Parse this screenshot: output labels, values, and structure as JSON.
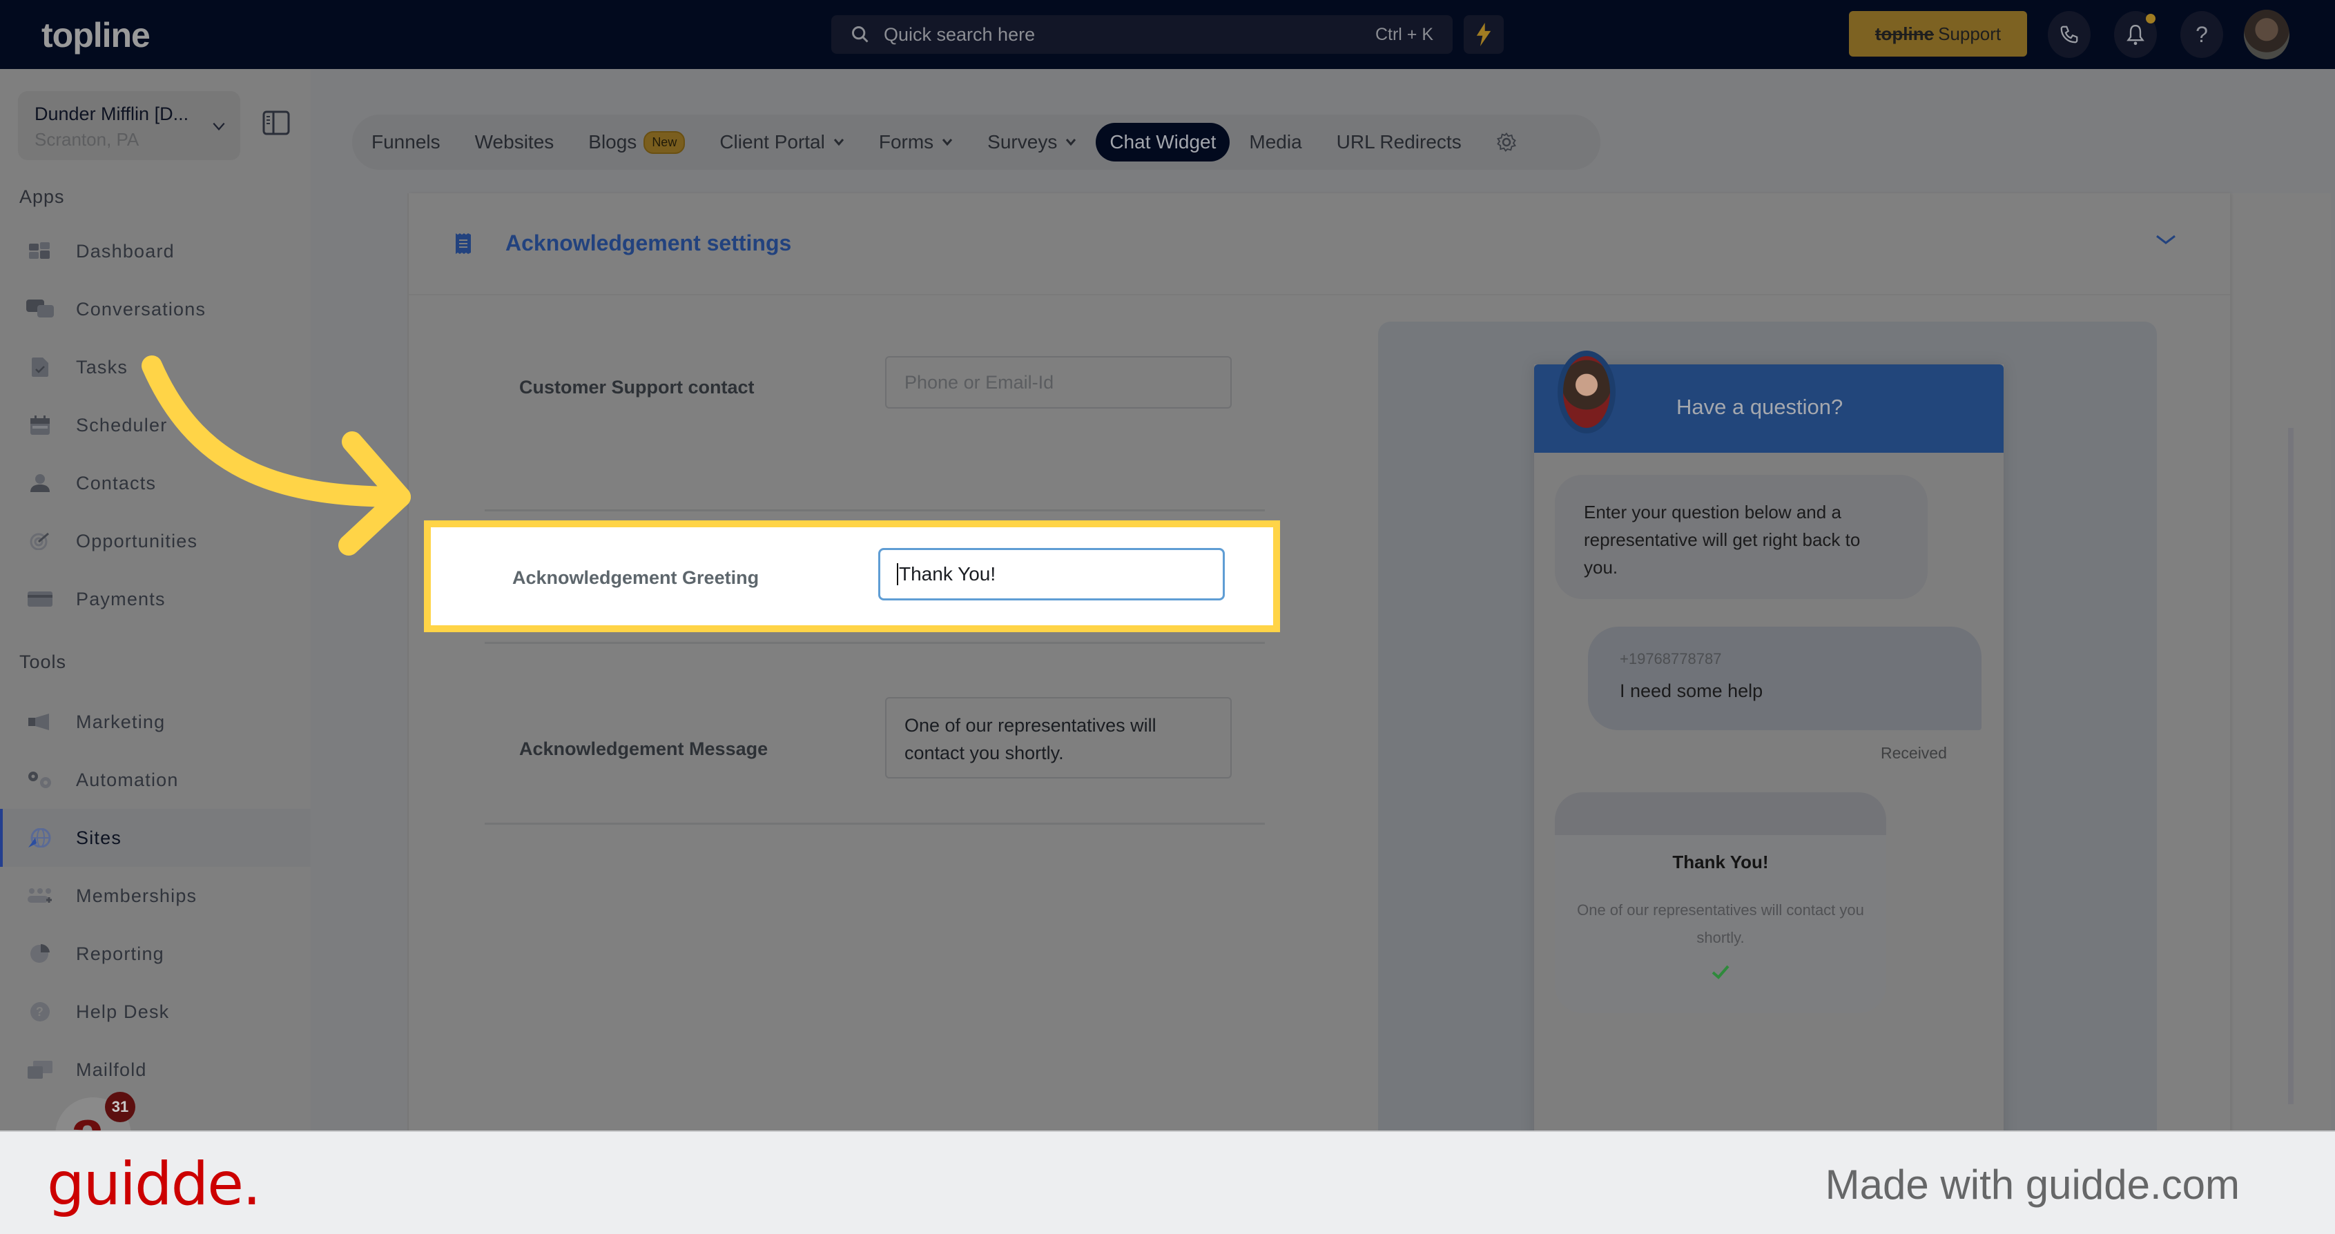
{
  "topbar": {
    "logo": "topline",
    "search_placeholder": "Quick search here",
    "search_shortcut": "Ctrl + K",
    "support_brand": "topline",
    "support_label": "Support",
    "help_glyph": "?"
  },
  "sidebar": {
    "location_name": "Dunder Mifflin [D...",
    "location_city": "Scranton, PA",
    "apps_label": "Apps",
    "tools_label": "Tools",
    "apps": [
      {
        "label": "Dashboard",
        "icon": "dashboard-icon"
      },
      {
        "label": "Conversations",
        "icon": "conversations-icon"
      },
      {
        "label": "Tasks",
        "icon": "tasks-icon"
      },
      {
        "label": "Scheduler",
        "icon": "calendar-icon"
      },
      {
        "label": "Contacts",
        "icon": "contact-icon"
      },
      {
        "label": "Opportunities",
        "icon": "target-icon"
      },
      {
        "label": "Payments",
        "icon": "credit-card-icon"
      }
    ],
    "tools": [
      {
        "label": "Marketing",
        "icon": "megaphone-icon"
      },
      {
        "label": "Automation",
        "icon": "gears-icon"
      },
      {
        "label": "Sites",
        "icon": "globe-icon",
        "active": true
      },
      {
        "label": "Memberships",
        "icon": "members-icon"
      },
      {
        "label": "Reporting",
        "icon": "pie-chart-icon"
      },
      {
        "label": "Help Desk",
        "icon": "help-circle-icon"
      },
      {
        "label": "Mailfold",
        "icon": "mail-icon"
      }
    ],
    "widget_letter": "a",
    "widget_badge": "31"
  },
  "tabs": [
    {
      "label": "Funnels"
    },
    {
      "label": "Websites"
    },
    {
      "label": "Blogs",
      "badge": "New"
    },
    {
      "label": "Client Portal",
      "dropdown": true
    },
    {
      "label": "Forms",
      "dropdown": true
    },
    {
      "label": "Surveys",
      "dropdown": true
    },
    {
      "label": "Chat Widget",
      "active": true
    },
    {
      "label": "Media"
    },
    {
      "label": "URL Redirects"
    }
  ],
  "section": {
    "title": "Acknowledgement settings",
    "fields": {
      "support_contact_label": "Customer Support contact",
      "support_contact_placeholder": "Phone or Email-Id",
      "greeting_label": "Acknowledgement Greeting",
      "greeting_value": "Thank You!",
      "message_label": "Acknowledgement Message",
      "message_value": "One of our representatives will contact you shortly."
    }
  },
  "preview": {
    "header_title": "Have a question?",
    "intro_message": "Enter your question below and a representative will get right back to you.",
    "user_phone": "+19768778787",
    "user_message": "I need some help",
    "status": "Received",
    "ack_title": "Thank You!",
    "ack_message": "One of our representatives will contact you shortly."
  },
  "colors": {
    "highlight": "#ffd447",
    "accent_blue": "#22427e",
    "active_tab": "#020a1e",
    "guidde_red": "#cc0000"
  },
  "footer": {
    "logo": "guidde.",
    "tagline": "Made with guidde.com"
  }
}
